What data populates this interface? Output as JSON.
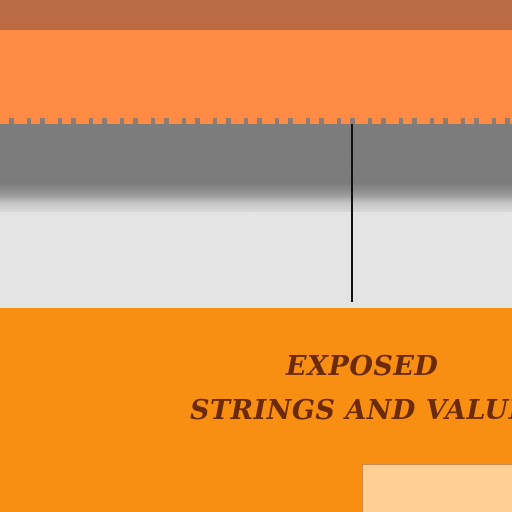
{
  "caption": {
    "line1": "Exposed",
    "line2": "Strings and Values"
  },
  "colors": {
    "top_strip": "#bb6b44",
    "orange_band": "#ff8b45",
    "gray_band": "#7c7c7c",
    "light_area": "#e4e4e4",
    "bottom_panel": "#f88f12",
    "caption_text": "#6b2a0a",
    "peach_box": "#ffcf94"
  }
}
